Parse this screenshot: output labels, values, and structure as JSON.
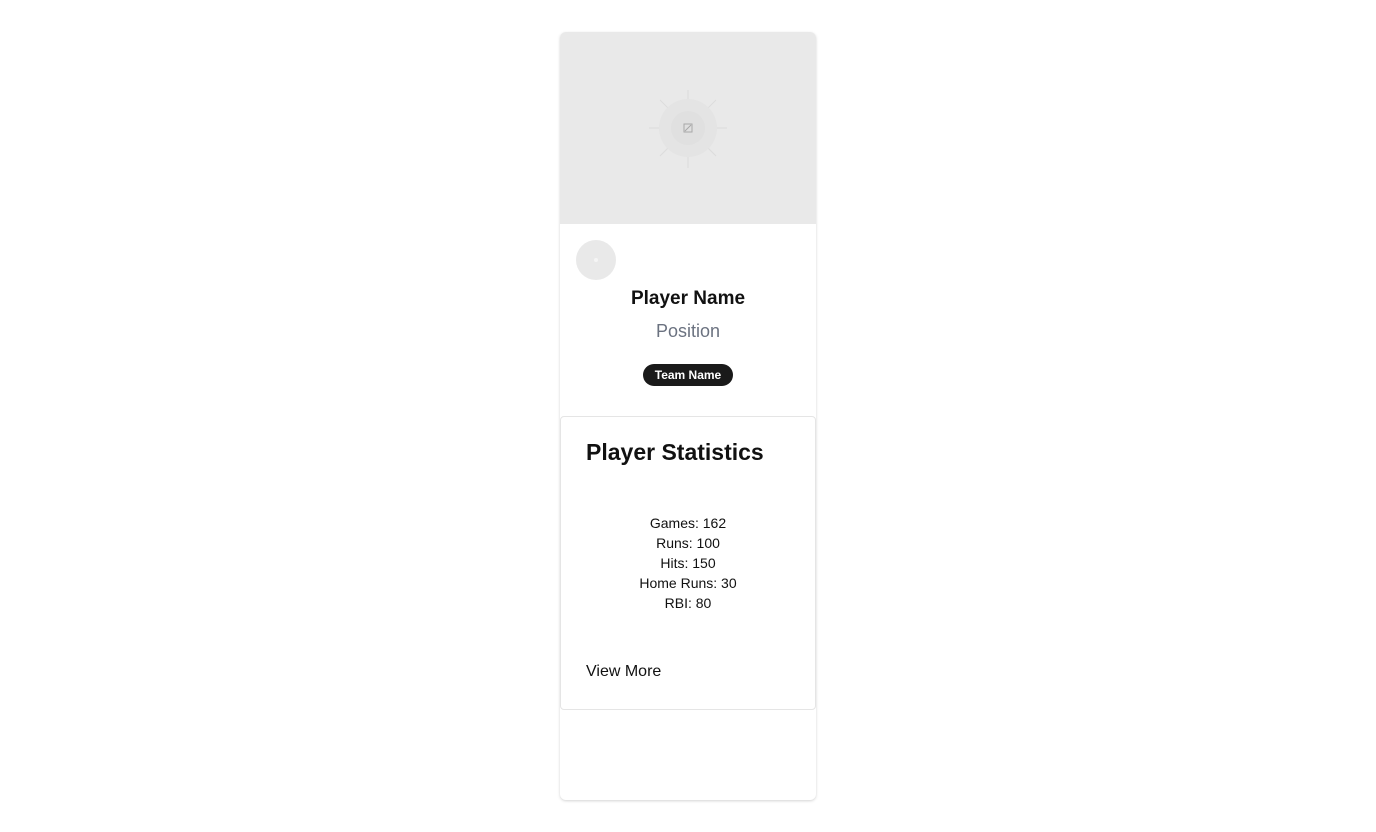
{
  "player": {
    "name": "Player Name",
    "position": "Position",
    "team": "Team Name"
  },
  "statistics": {
    "title": "Player Statistics",
    "items": [
      "Games: 162",
      "Runs: 100",
      "Hits: 150",
      "Home Runs: 30",
      "RBI: 80"
    ],
    "view_more": "View More"
  },
  "icons": {
    "hero": "image-placeholder-icon",
    "avatar": "avatar-placeholder"
  },
  "colors": {
    "placeholder_bg": "#e9e9e9",
    "badge_bg": "#1a1a1a",
    "muted_text": "#6b7280"
  }
}
